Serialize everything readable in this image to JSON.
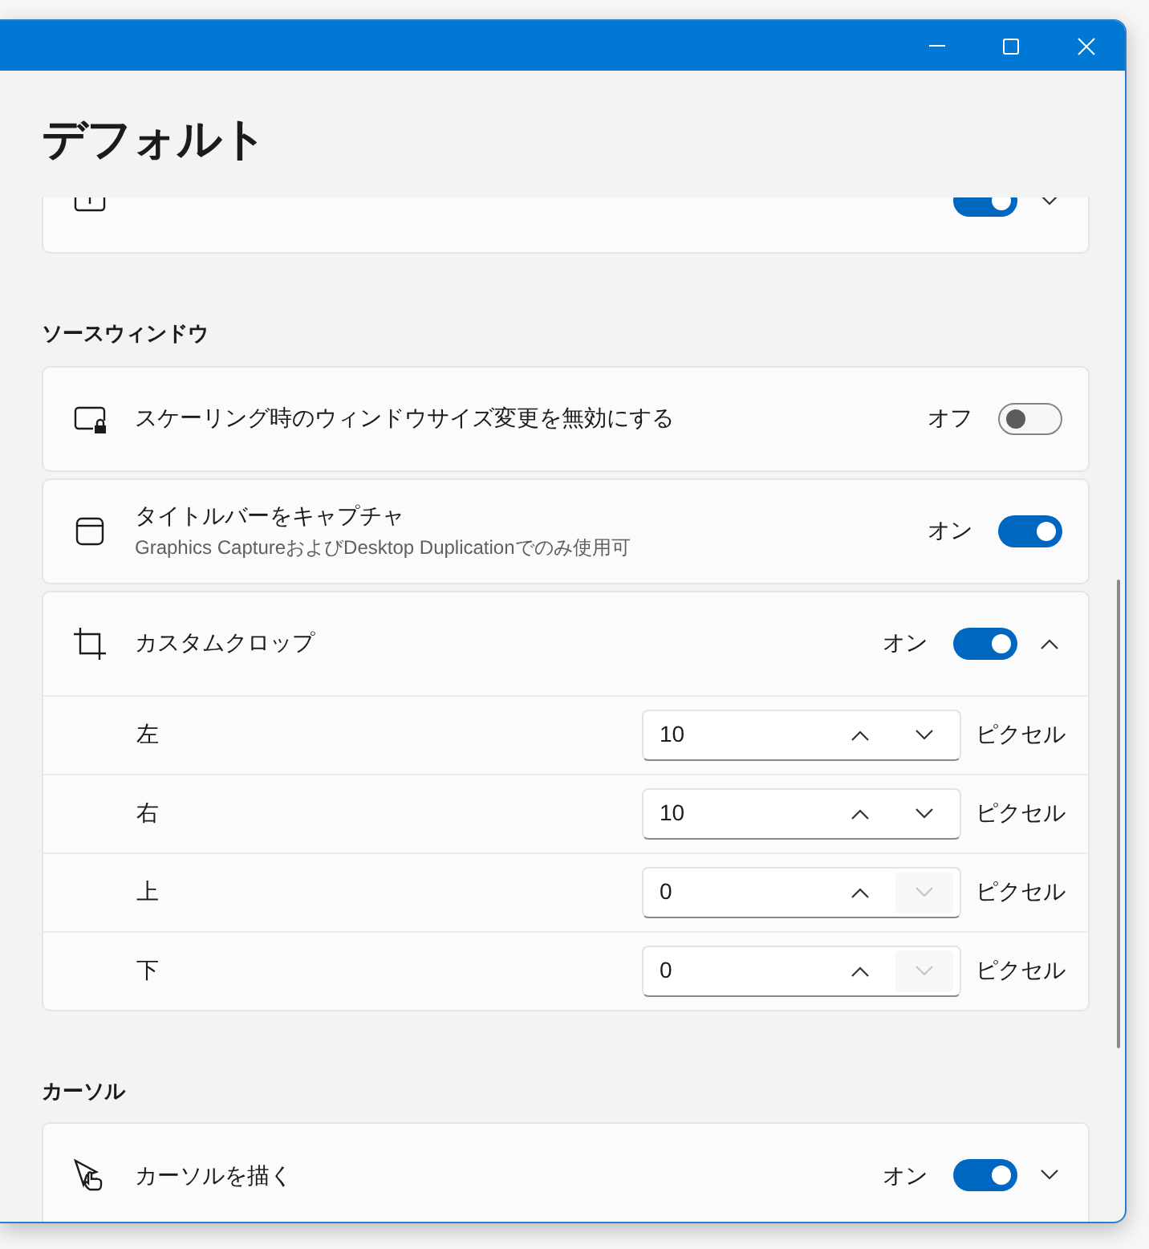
{
  "page_title": "デフォルト",
  "sections": [
    {
      "items": [
        {
          "kind": "toggle",
          "on": true,
          "expanded": false
        }
      ]
    },
    {
      "heading": "ソースウィンドウ",
      "items": [
        {
          "kind": "toggle",
          "label": "スケーリング時のウィンドウサイズ変更を無効にする",
          "state_text": "オフ",
          "on": false
        },
        {
          "kind": "toggle",
          "label": "タイトルバーをキャプチャ",
          "description": "Graphics CaptureおよびDesktop Duplicationでのみ使用可",
          "state_text": "オン",
          "on": true
        },
        {
          "kind": "toggle",
          "label": "カスタムクロップ",
          "state_text": "オン",
          "on": true,
          "expanded": true,
          "sub_rows": [
            {
              "label": "左",
              "value": "10",
              "unit": "ピクセル",
              "up_disabled": false,
              "down_disabled": false
            },
            {
              "label": "右",
              "value": "10",
              "unit": "ピクセル",
              "up_disabled": false,
              "down_disabled": false
            },
            {
              "label": "上",
              "value": "0",
              "unit": "ピクセル",
              "up_disabled": false,
              "down_disabled": true
            },
            {
              "label": "下",
              "value": "0",
              "unit": "ピクセル",
              "up_disabled": false,
              "down_disabled": true
            }
          ]
        }
      ]
    },
    {
      "heading": "カーソル",
      "items": [
        {
          "kind": "toggle",
          "label": "カーソルを描く",
          "state_text": "オン",
          "on": true,
          "expanded": false
        },
        {
          "kind": "blank"
        }
      ]
    }
  ]
}
